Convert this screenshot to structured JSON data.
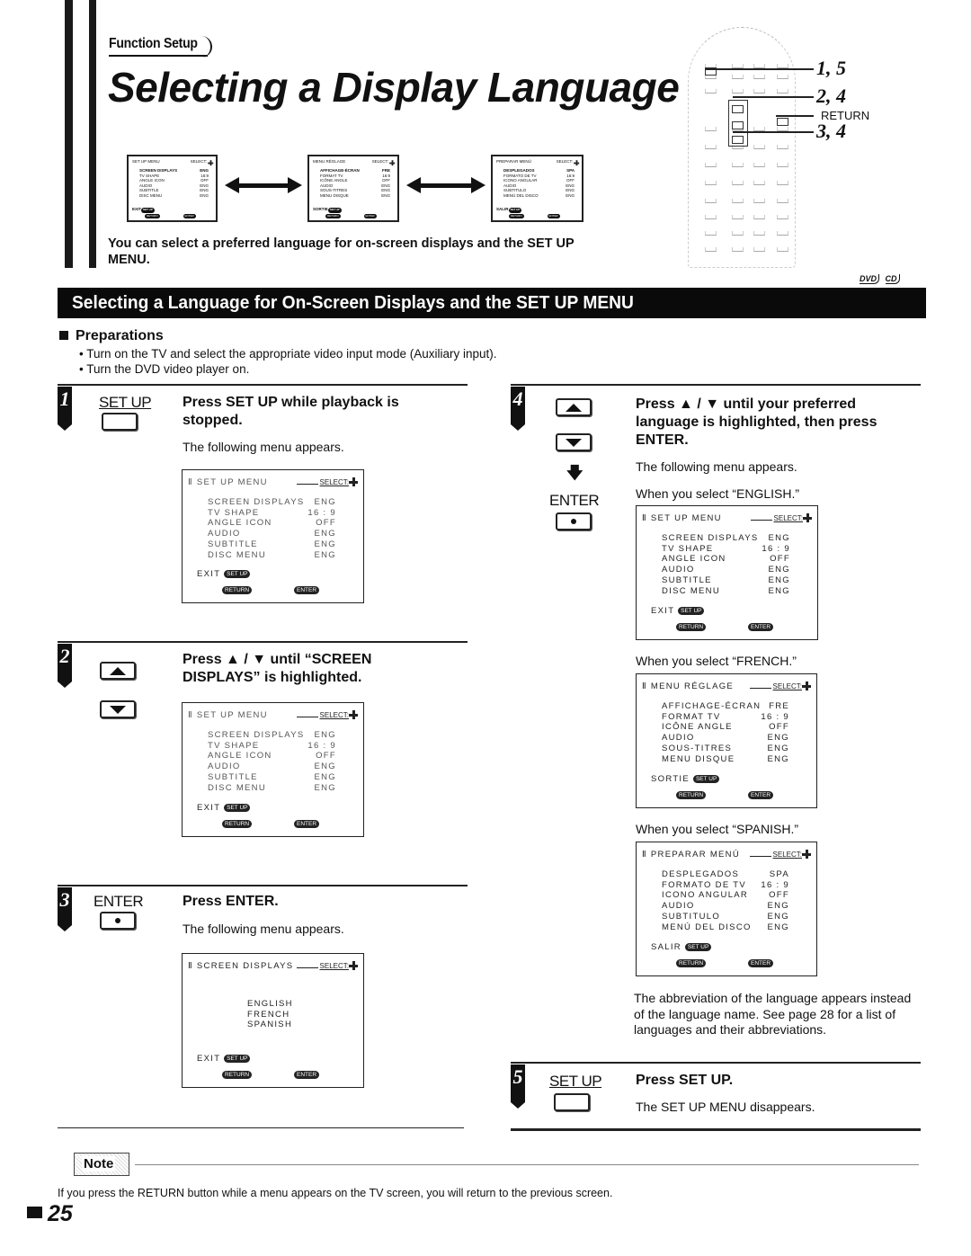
{
  "header": {
    "breadcrumb": "Function Setup",
    "title": "Selecting a Display Language",
    "intro": "You can select a preferred language for on-screen displays and the SET UP MENU."
  },
  "preview_menus": [
    {
      "title": "SET UP MENU",
      "select": "SELECT:",
      "rows": [
        [
          "SCREEN DISPLAYS",
          "ENG"
        ],
        [
          "TV SHAPE",
          "16:9"
        ],
        [
          "ANGLE ICON",
          "OFF"
        ],
        [
          "AUDIO",
          "ENG"
        ],
        [
          "SUBTITLE",
          "ENG"
        ],
        [
          "DISC MENU",
          "ENG"
        ]
      ],
      "exit": "EXIT",
      "pill_setup": "SET UP",
      "pill_return": "RETURN",
      "pill_enter": "ENTER"
    },
    {
      "title": "MENU RÉGLAGE",
      "select": "SELECT:",
      "rows": [
        [
          "AFFICHAGE-ÉCRAN",
          "FRE"
        ],
        [
          "FORMAT TV",
          "16:9"
        ],
        [
          "ICÔNE ANGLE",
          "OFF"
        ],
        [
          "AUDIO",
          "ENG"
        ],
        [
          "SOUS-TITRES",
          "ENG"
        ],
        [
          "MENU DISQUE",
          "ENG"
        ]
      ],
      "exit": "SORTIE",
      "pill_setup": "SET UP",
      "pill_return": "RETURN",
      "pill_enter": "ENTER"
    },
    {
      "title": "PREPARAR MENÚ",
      "select": "SELECT:",
      "rows": [
        [
          "DESPLEGADOS",
          "SPA"
        ],
        [
          "FORMATO DE TV",
          "16:9"
        ],
        [
          "ICONO ANGULAR",
          "OFF"
        ],
        [
          "AUDIO",
          "ENG"
        ],
        [
          "SUBTITULO",
          "ENG"
        ],
        [
          "MENÚ DEL DISCO",
          "ENG"
        ]
      ],
      "exit": "SALIR",
      "pill_setup": "SET UP",
      "pill_return": "RETURN",
      "pill_enter": "ENTER"
    }
  ],
  "remote": {
    "callouts": [
      "1, 5",
      "2, 4",
      "RETURN",
      "3, 4"
    ]
  },
  "section": {
    "title": "Selecting a Language for On-Screen Displays and the SET UP MENU",
    "badges": [
      "DVD",
      "CD"
    ]
  },
  "preparations": {
    "title": "Preparations",
    "items": [
      "• Turn on the TV and select the appropriate video input mode (Auxiliary input).",
      "• Turn the DVD video player on."
    ]
  },
  "steps": [
    {
      "number": "1",
      "button_label": "SET UP",
      "heading": "Press SET UP while playback is stopped.",
      "text": "The following menu appears.",
      "menu": {
        "title": "SET UP MENU",
        "select": "SELECT:",
        "rows": [
          [
            "SCREEN DISPLAYS",
            "ENG"
          ],
          [
            "TV SHAPE",
            "16 : 9"
          ],
          [
            "ANGLE ICON",
            "OFF"
          ],
          [
            "AUDIO",
            "ENG"
          ],
          [
            "SUBTITLE",
            "ENG"
          ],
          [
            "DISC MENU",
            "ENG"
          ]
        ],
        "exit": "EXIT",
        "pill_setup": "SET UP",
        "pill_return": "RETURN",
        "pill_enter": "ENTER"
      }
    },
    {
      "number": "2",
      "heading": "Press ▲ / ▼ until “SCREEN DISPLAYS” is highlighted.",
      "menu": {
        "title": "SET UP MENU",
        "select": "SELECT:",
        "rows": [
          [
            "SCREEN DISPLAYS",
            "ENG"
          ],
          [
            "TV SHAPE",
            "16 : 9"
          ],
          [
            "ANGLE ICON",
            "OFF"
          ],
          [
            "AUDIO",
            "ENG"
          ],
          [
            "SUBTITLE",
            "ENG"
          ],
          [
            "DISC MENU",
            "ENG"
          ]
        ],
        "exit": "EXIT",
        "pill_setup": "SET UP",
        "pill_return": "RETURN",
        "pill_enter": "ENTER"
      }
    },
    {
      "number": "3",
      "button_label": "ENTER",
      "heading": "Press ENTER.",
      "text": "The following menu appears.",
      "menu": {
        "title": "SCREEN DISPLAYS",
        "select": "SELECT:",
        "languages": [
          "ENGLISH",
          "FRENCH",
          "SPANISH"
        ],
        "exit": "EXIT",
        "pill_setup": "SET UP",
        "pill_return": "RETURN",
        "pill_enter": "ENTER"
      }
    },
    {
      "number": "4",
      "button_label": "ENTER",
      "heading": "Press ▲ / ▼ until your preferred language is highlighted, then press ENTER.",
      "text": "The following menu appears.",
      "variants": [
        {
          "caption": "When you select “ENGLISH.”",
          "menu": {
            "title": "SET UP MENU",
            "select": "SELECT:",
            "rows": [
              [
                "SCREEN DISPLAYS",
                "ENG"
              ],
              [
                "TV SHAPE",
                "16 : 9"
              ],
              [
                "ANGLE ICON",
                "OFF"
              ],
              [
                "AUDIO",
                "ENG"
              ],
              [
                "SUBTITLE",
                "ENG"
              ],
              [
                "DISC MENU",
                "ENG"
              ]
            ],
            "exit": "EXIT",
            "pill_setup": "SET UP",
            "pill_return": "RETURN",
            "pill_enter": "ENTER"
          }
        },
        {
          "caption": "When you select “FRENCH.”",
          "menu": {
            "title": "MENU RÉGLAGE",
            "select": "SELECT:",
            "rows": [
              [
                "AFFICHAGE-ÉCRAN",
                "FRE"
              ],
              [
                "FORMAT TV",
                "16 : 9"
              ],
              [
                "ICÔNE ANGLE",
                "OFF"
              ],
              [
                "AUDIO",
                "ENG"
              ],
              [
                "SOUS-TITRES",
                "ENG"
              ],
              [
                "MENU DISQUE",
                "ENG"
              ]
            ],
            "exit": "SORTIE",
            "pill_setup": "SET UP",
            "pill_return": "RETURN",
            "pill_enter": "ENTER"
          }
        },
        {
          "caption": "When you select “SPANISH.”",
          "menu": {
            "title": "PREPARAR MENÚ",
            "select": "SELECT:",
            "rows": [
              [
                "DESPLEGADOS",
                "SPA"
              ],
              [
                "FORMATO DE TV",
                "16 : 9"
              ],
              [
                "ICONO ANGULAR",
                "OFF"
              ],
              [
                "AUDIO",
                "ENG"
              ],
              [
                "SUBTITULO",
                "ENG"
              ],
              [
                "MENÚ DEL DISCO",
                "ENG"
              ]
            ],
            "exit": "SALIR",
            "pill_setup": "SET UP",
            "pill_return": "RETURN",
            "pill_enter": "ENTER"
          }
        }
      ],
      "footnote": "The abbreviation of the language appears instead of the language name. See page 28 for a list of languages and their abbreviations."
    },
    {
      "number": "5",
      "button_label": "SET UP",
      "heading": "Press SET UP.",
      "text": "The SET UP MENU disappears."
    }
  ],
  "note": {
    "label": "Note",
    "text": "If you press the RETURN button while a menu appears on the TV screen, you will return to the previous screen."
  },
  "page_number": "25"
}
